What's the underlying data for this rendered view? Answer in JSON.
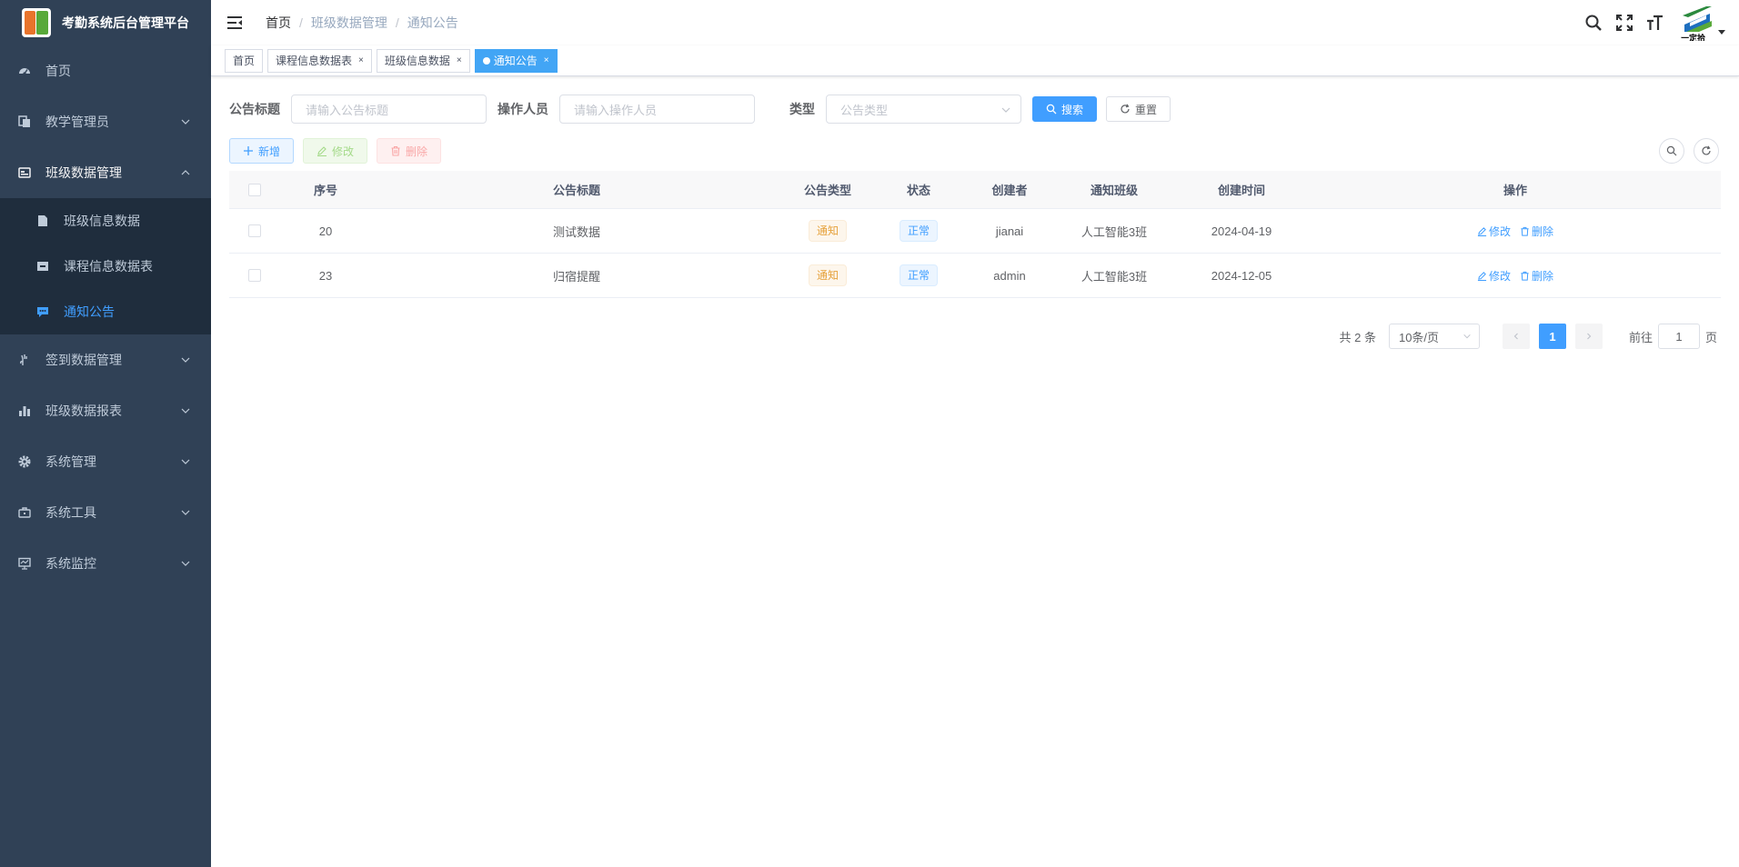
{
  "app": {
    "title": "考勤系统后台管理平台"
  },
  "sidebar": {
    "items": [
      {
        "label": "首页",
        "icon": "dashboard-icon"
      },
      {
        "label": "教学管理员",
        "icon": "documents-icon"
      },
      {
        "label": "班级数据管理",
        "icon": "id-card-icon",
        "expanded": true,
        "children": [
          {
            "label": "班级信息数据",
            "icon": "file-icon"
          },
          {
            "label": "课程信息数据表",
            "icon": "archive-icon"
          },
          {
            "label": "通知公告",
            "icon": "message-icon",
            "active": true
          }
        ]
      },
      {
        "label": "签到数据管理",
        "icon": "hand-icon"
      },
      {
        "label": "班级数据报表",
        "icon": "bar-chart-icon"
      },
      {
        "label": "系统管理",
        "icon": "gear-icon"
      },
      {
        "label": "系统工具",
        "icon": "toolbox-icon"
      },
      {
        "label": "系统监控",
        "icon": "monitor-icon"
      }
    ]
  },
  "navbar": {
    "breadcrumb": [
      "首页",
      "班级数据管理",
      "通知公告"
    ],
    "avatar_text": "一定拾"
  },
  "tags": [
    {
      "label": "首页",
      "closable": false
    },
    {
      "label": "课程信息数据表",
      "closable": true
    },
    {
      "label": "班级信息数据",
      "closable": true
    },
    {
      "label": "通知公告",
      "closable": true,
      "active": true
    }
  ],
  "tag_close_glyph": "×",
  "search": {
    "title_label": "公告标题",
    "title_placeholder": "请输入公告标题",
    "operator_label": "操作人员",
    "operator_placeholder": "请输入操作人员",
    "type_label": "类型",
    "type_placeholder": "公告类型",
    "search_button": "搜索",
    "reset_button": "重置"
  },
  "toolbar": {
    "add_label": "新增",
    "edit_label": "修改",
    "delete_label": "删除"
  },
  "table": {
    "columns": [
      "序号",
      "公告标题",
      "公告类型",
      "状态",
      "创建者",
      "通知班级",
      "创建时间",
      "操作"
    ],
    "rows": [
      {
        "id": "20",
        "title": "测试数据",
        "type": "通知",
        "status": "正常",
        "creator": "jianai",
        "class": "人工智能3班",
        "time": "2024-04-19",
        "edit": "修改",
        "delete": "删除"
      },
      {
        "id": "23",
        "title": "归宿提醒",
        "type": "通知",
        "status": "正常",
        "creator": "admin",
        "class": "人工智能3班",
        "time": "2024-12-05",
        "edit": "修改",
        "delete": "删除"
      }
    ]
  },
  "pagination": {
    "total": "共 2 条",
    "page_size": "10条/页",
    "current_page": "1",
    "goto_label": "前往",
    "goto_value": "1",
    "page_suffix": "页"
  },
  "colors": {
    "sidebar_bg": "#304156",
    "submenu_bg": "#1f2d3d",
    "primary": "#409eff",
    "active_tag": "#42a5f5"
  }
}
